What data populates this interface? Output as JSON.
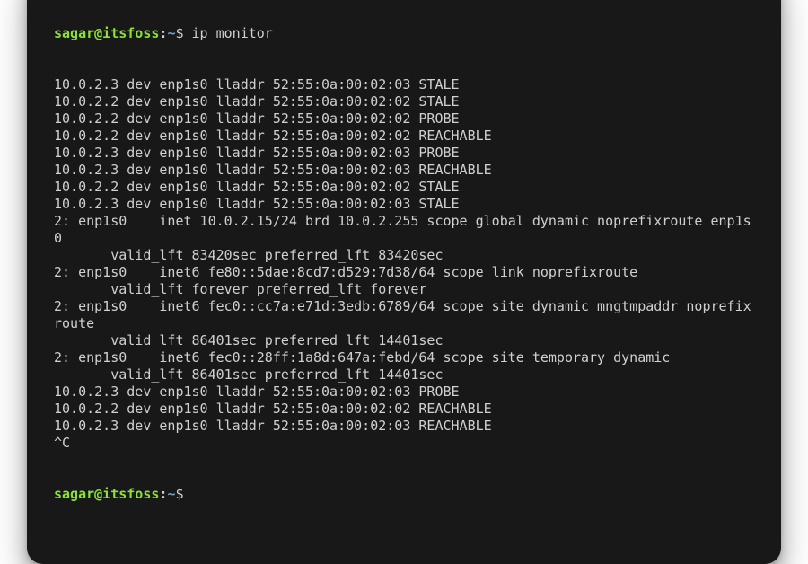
{
  "prompt": {
    "userhost": "sagar@itsfoss",
    "colon": ":",
    "path": "~",
    "dollar": "$"
  },
  "command": "ip monitor",
  "output_lines": [
    "10.0.2.3 dev enp1s0 lladdr 52:55:0a:00:02:03 STALE",
    "10.0.2.2 dev enp1s0 lladdr 52:55:0a:00:02:02 STALE",
    "10.0.2.2 dev enp1s0 lladdr 52:55:0a:00:02:02 PROBE",
    "10.0.2.2 dev enp1s0 lladdr 52:55:0a:00:02:02 REACHABLE",
    "10.0.2.3 dev enp1s0 lladdr 52:55:0a:00:02:03 PROBE",
    "10.0.2.3 dev enp1s0 lladdr 52:55:0a:00:02:03 REACHABLE",
    "10.0.2.2 dev enp1s0 lladdr 52:55:0a:00:02:02 STALE",
    "10.0.2.3 dev enp1s0 lladdr 52:55:0a:00:02:03 STALE",
    "2: enp1s0    inet 10.0.2.15/24 brd 10.0.2.255 scope global dynamic noprefixroute enp1s0",
    "       valid_lft 83420sec preferred_lft 83420sec",
    "2: enp1s0    inet6 fe80::5dae:8cd7:d529:7d38/64 scope link noprefixroute",
    "       valid_lft forever preferred_lft forever",
    "2: enp1s0    inet6 fec0::cc7a:e71d:3edb:6789/64 scope site dynamic mngtmpaddr noprefixroute",
    "       valid_lft 86401sec preferred_lft 14401sec",
    "2: enp1s0    inet6 fec0::28ff:1a8d:647a:febd/64 scope site temporary dynamic",
    "       valid_lft 86401sec preferred_lft 14401sec",
    "10.0.2.3 dev enp1s0 lladdr 52:55:0a:00:02:03 PROBE",
    "10.0.2.2 dev enp1s0 lladdr 52:55:0a:00:02:02 REACHABLE",
    "10.0.2.3 dev enp1s0 lladdr 52:55:0a:00:02:03 REACHABLE",
    "^C"
  ]
}
